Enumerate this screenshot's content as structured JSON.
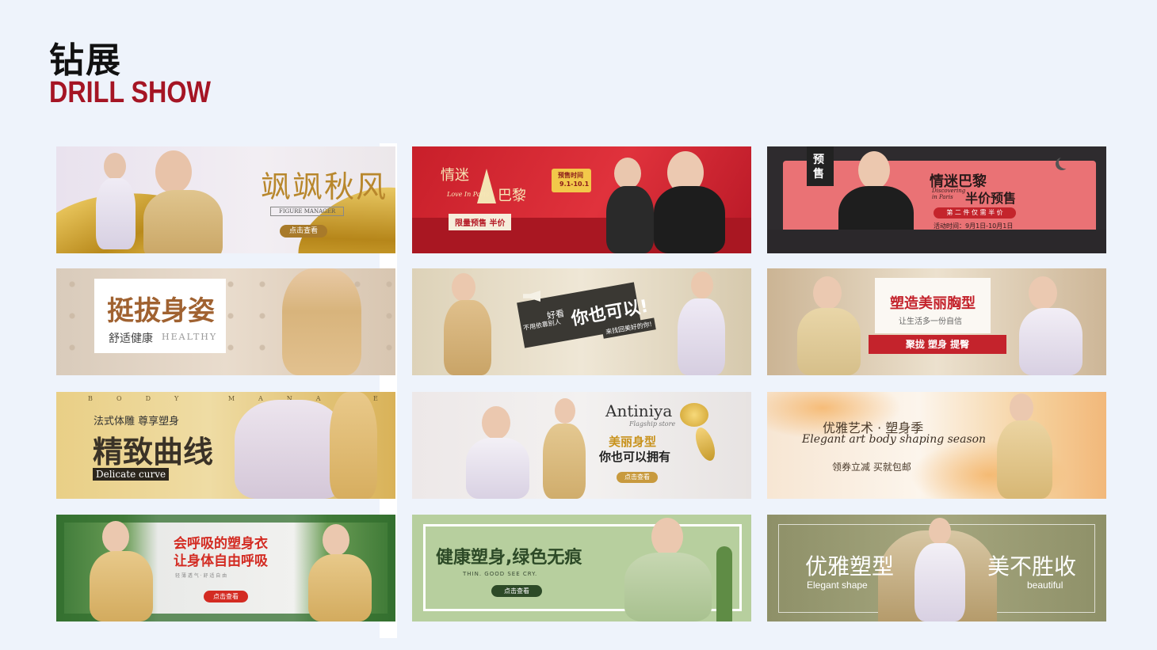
{
  "header": {
    "title_zh": "钻展",
    "title_en": "DRILL SHOW"
  },
  "banners": {
    "b1": {
      "headline": "飒飒秋风",
      "sub": "FIGURE MANAGER",
      "button": "点击查看"
    },
    "b2": {
      "headline_a": "情迷",
      "headline_b": "巴黎",
      "script": "Love In Paris",
      "badge_title": "预售时间",
      "badge_date": "9.1-10.1",
      "offer": "限量预售  半价"
    },
    "b3": {
      "tag_a": "预",
      "tag_b": "售",
      "headline": "情迷巴黎",
      "script": "Discovering in Paris",
      "sub": "半价预售",
      "pill": "第 二 件 仅 需 半 价",
      "date": "活动时间：9月1日-10月1日"
    },
    "b4": {
      "headline": "挺拔身姿",
      "sub": "舒适健康",
      "sub_en": "HEALTHY"
    },
    "b5": {
      "small_a": "好看",
      "small_b": "不用依靠别人",
      "headline": "你也可以!",
      "tag": "来找回美好的你!"
    },
    "b6": {
      "headline": "塑造美丽胸型",
      "sub": "让生活多一份自信",
      "bar": "聚拢  塑身  提臀"
    },
    "b7": {
      "top": "BODY MANAGE",
      "sub": "法式体雕  尊享塑身",
      "headline": "精致曲线",
      "tag": "Delicate curve"
    },
    "b8": {
      "brand": "Antiniya",
      "brand_sub": "Flagship store",
      "headline_a": "美丽身型",
      "headline_b": "你也可以拥有",
      "button": "点击查看"
    },
    "b9": {
      "headline": "优雅艺术 · 塑身季",
      "script": "Elegant art  body shaping season",
      "sub": "领券立减  买就包邮"
    },
    "b10": {
      "headline_a": "会呼吸的塑身衣",
      "headline_b": "让身体自由呼吸",
      "tiny": "轻 薄 透 气 · 舒 适 自 由",
      "button": "点击查看"
    },
    "b11": {
      "headline": "健康塑身,绿色无痕",
      "sub": "THIN. GOOD SEE CRY.",
      "button": "点击查看"
    },
    "b12": {
      "left_headline": "优雅塑型",
      "left_sub": "Elegant shape",
      "right_headline": "美不胜收",
      "right_sub": "beautiful"
    }
  }
}
